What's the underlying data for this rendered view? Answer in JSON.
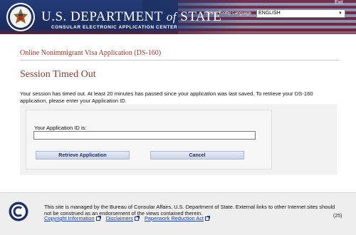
{
  "header": {
    "title_part1": "U.S. DEPARTMENT ",
    "title_of": "of",
    "title_part2": " STATE",
    "subtitle": "CONSULAR ELECTRONIC APPLICATION CENTER",
    "exit_label": "Exit",
    "tooltip_label": "Select Tooltip Language",
    "language_value": "ENGLISH",
    "seal_icon": "dept-of-state-seal-icon"
  },
  "form": {
    "title": "Online Nonimmigrant Visa Application (DS-160)",
    "heading": "Session Timed Out",
    "message": "Your session has timed out. At least 20 minutes has passed since your application was last saved. To retrieve your DS-160 application, please enter your Application ID.",
    "appid_label": "Your Application ID is:",
    "appid_value": "",
    "retrieve_label": "Retrieve Application",
    "cancel_label": "Cancel"
  },
  "footer": {
    "text": "This site is managed by the Bureau of Consular Affairs, U.S. Department of State. External links to other Internet sites should not be construed as an endorsement of the views contained therein.",
    "links": [
      "Copyright Information",
      "Disclaimers",
      "Paperwork Reduction Act"
    ],
    "version": "(25)",
    "seal_icon": "consular-affairs-seal-icon"
  },
  "colors": {
    "header_blue": "#1e3166",
    "title_brown": "#8b3a2e",
    "link_blue": "#1f3ea0"
  }
}
